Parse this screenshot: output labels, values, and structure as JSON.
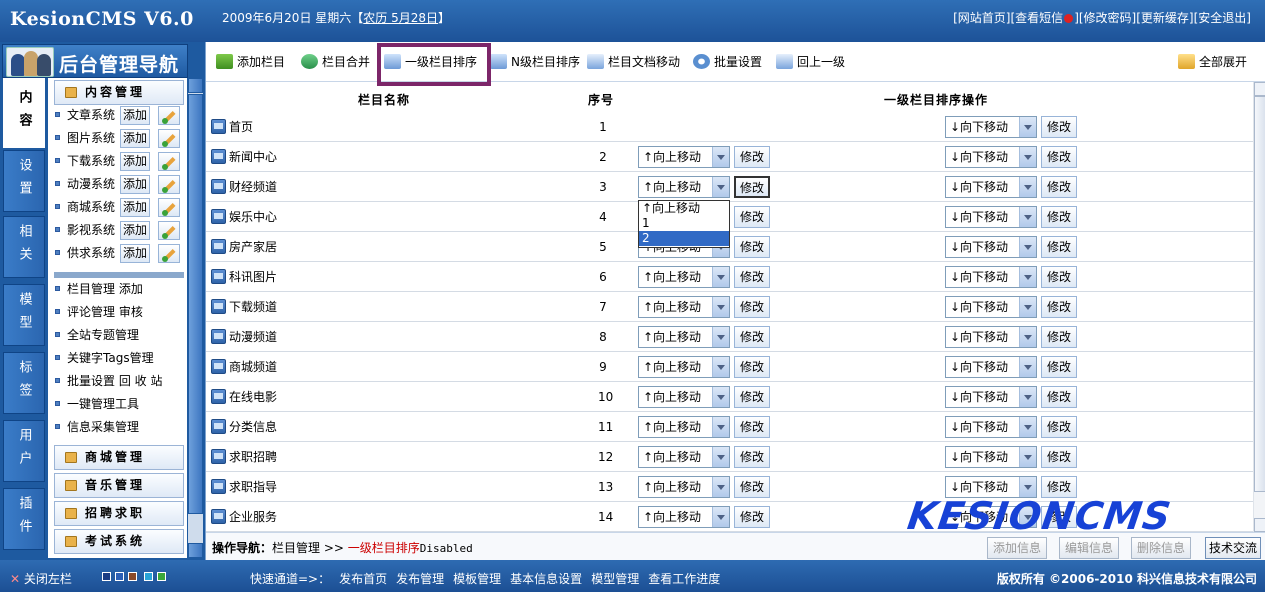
{
  "app": {
    "title": "KesionCMS V6.0"
  },
  "header": {
    "date_prefix": "2009年6月20日 星期六【",
    "lunar": "农历 5月28日",
    "date_suffix": "】",
    "links": [
      "[网站首页]",
      "[查看短信",
      "]",
      "[修改密码]",
      "[更新缓存]",
      "[安全退出]"
    ]
  },
  "sidebar": {
    "nav_title": "后台管理导航",
    "tabs": [
      "内容",
      "设置",
      "相关",
      "模型",
      "标签",
      "用户",
      "插件"
    ],
    "section_content": "内容管理",
    "add_label": "添加",
    "modules": [
      "文章系统",
      "图片系统",
      "下载系统",
      "动漫系统",
      "商城系统",
      "影视系统",
      "供求系统"
    ],
    "links": [
      "栏目管理 添加",
      "评论管理 审核",
      "全站专题管理",
      "关键字Tags管理",
      "批量设置 回 收 站",
      "一键管理工具",
      "信息采集管理"
    ],
    "sections": [
      "商城管理",
      "音乐管理",
      "招聘求职",
      "考试系统"
    ]
  },
  "toolbar": {
    "add_channel": "添加栏目",
    "merge_channel": "栏目合并",
    "level1_sort": "一级栏目排序",
    "sub_sort": "N级栏目排序",
    "move_docs": "栏目文档移动",
    "batch_setting": "批量设置",
    "up_level": "回上一级",
    "expand_all": "全部展开"
  },
  "table": {
    "headers": {
      "name": "栏目名称",
      "order": "序号",
      "op": "一级栏目排序操作"
    },
    "move_up": "↑向上移动",
    "move_down": "↓向下移动",
    "modify": "修改",
    "rows": [
      {
        "name": "首页",
        "order": "1"
      },
      {
        "name": "新闻中心",
        "order": "2"
      },
      {
        "name": "财经频道",
        "order": "3"
      },
      {
        "name": "娱乐中心",
        "order": "4"
      },
      {
        "name": "房产家居",
        "order": "5"
      },
      {
        "name": "科讯图片",
        "order": "6"
      },
      {
        "name": "下载频道",
        "order": "7"
      },
      {
        "name": "动漫频道",
        "order": "8"
      },
      {
        "name": "商城频道",
        "order": "9"
      },
      {
        "name": "在线电影",
        "order": "10"
      },
      {
        "name": "分类信息",
        "order": "11"
      },
      {
        "name": "求职招聘",
        "order": "12"
      },
      {
        "name": "求职指导",
        "order": "13"
      },
      {
        "name": "企业服务",
        "order": "14"
      }
    ],
    "dropdown_options": [
      "↑向上移动",
      "1",
      "2"
    ]
  },
  "watermark": "KESIONCMS",
  "opbar": {
    "label": "操作导航：",
    "crumb": "栏目管理 >> ",
    "current": "一级栏目排序",
    "status": "Disabled",
    "buttons": [
      "添加信息",
      "编辑信息",
      "删除信息",
      "技术交流"
    ]
  },
  "footer": {
    "close_left": "关闭左栏",
    "quick_label": "快速通道=>：",
    "quick_links": [
      "发布首页",
      "发布管理",
      "模板管理",
      "基本信息设置",
      "模型管理",
      "查看工作进度"
    ],
    "copyright": "版权所有 ©2006-2010 科兴信息技术有限公司",
    "skins": [
      "#1b3d84",
      "#2b5fb5",
      "#8a4a2a",
      "#29a5d8",
      "#3aa83a"
    ]
  }
}
